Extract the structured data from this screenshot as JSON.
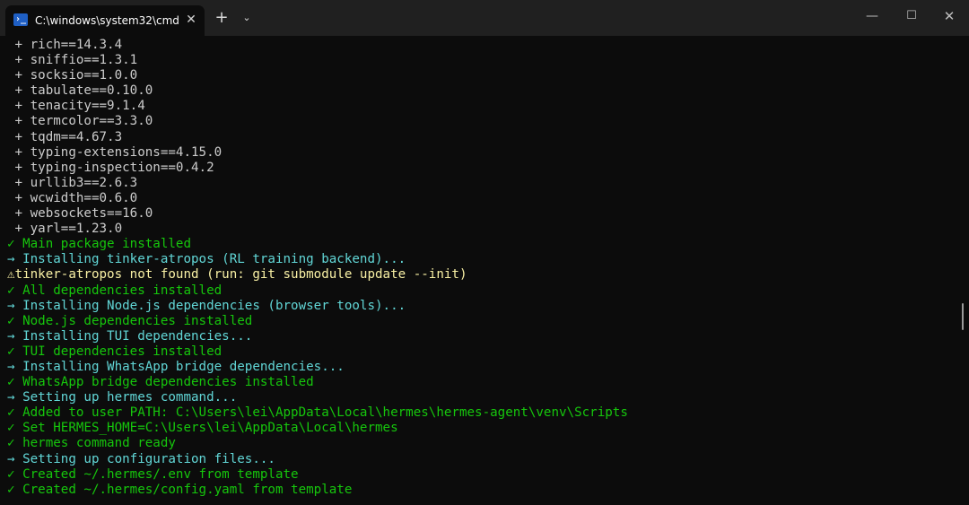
{
  "titlebar": {
    "tab_title": "C:\\windows\\system32\\cmd.exe",
    "tab_icon_glyph": "›_",
    "close_tab_glyph": "✕",
    "new_tab_glyph": "+",
    "dropdown_glyph": "⌄",
    "minimize_glyph": "—",
    "maximize_glyph": "☐",
    "close_glyph": "✕"
  },
  "colors": {
    "background": "#0c0c0c",
    "titlebar": "#202020",
    "default_text": "#cccccc",
    "success_green": "#16c60c",
    "info_cyan": "#61d6d6",
    "warning_yellow": "#f9f1a5"
  },
  "terminal": {
    "lines": [
      {
        "text": " + rich==14.3.4",
        "kind": "w"
      },
      {
        "text": " + sniffio==1.3.1",
        "kind": "w"
      },
      {
        "text": " + socksio==1.0.0",
        "kind": "w"
      },
      {
        "text": " + tabulate==0.10.0",
        "kind": "w"
      },
      {
        "text": " + tenacity==9.1.4",
        "kind": "w"
      },
      {
        "text": " + termcolor==3.3.0",
        "kind": "w"
      },
      {
        "text": " + tqdm==4.67.3",
        "kind": "w"
      },
      {
        "text": " + typing-extensions==4.15.0",
        "kind": "w"
      },
      {
        "text": " + typing-inspection==0.4.2",
        "kind": "w"
      },
      {
        "text": " + urllib3==2.6.3",
        "kind": "w"
      },
      {
        "text": " + wcwidth==0.6.0",
        "kind": "w"
      },
      {
        "text": " + websockets==16.0",
        "kind": "w"
      },
      {
        "text": " + yarl==1.23.0",
        "kind": "w"
      },
      {
        "text": "✓ Main package installed",
        "kind": "g"
      },
      {
        "text": "→ Installing tinker-atropos (RL training backend)...",
        "kind": "c"
      },
      {
        "text": "⚠tinker-atropos not found (run: git submodule update --init)",
        "kind": "y"
      },
      {
        "text": "✓ All dependencies installed",
        "kind": "g"
      },
      {
        "text": "→ Installing Node.js dependencies (browser tools)...",
        "kind": "c"
      },
      {
        "text": "✓ Node.js dependencies installed",
        "kind": "g"
      },
      {
        "text": "→ Installing TUI dependencies...",
        "kind": "c"
      },
      {
        "text": "✓ TUI dependencies installed",
        "kind": "g"
      },
      {
        "text": "→ Installing WhatsApp bridge dependencies...",
        "kind": "c"
      },
      {
        "text": "✓ WhatsApp bridge dependencies installed",
        "kind": "g"
      },
      {
        "text": "→ Setting up hermes command...",
        "kind": "c"
      },
      {
        "text": "✓ Added to user PATH: C:\\Users\\lei\\AppData\\Local\\hermes\\hermes-agent\\venv\\Scripts",
        "kind": "g"
      },
      {
        "text": "✓ Set HERMES_HOME=C:\\Users\\lei\\AppData\\Local\\hermes",
        "kind": "g"
      },
      {
        "text": "✓ hermes command ready",
        "kind": "g"
      },
      {
        "text": "→ Setting up configuration files...",
        "kind": "c"
      },
      {
        "text": "✓ Created ~/.hermes/.env from template",
        "kind": "g"
      },
      {
        "text": "✓ Created ~/.hermes/config.yaml from template",
        "kind": "g"
      }
    ]
  }
}
